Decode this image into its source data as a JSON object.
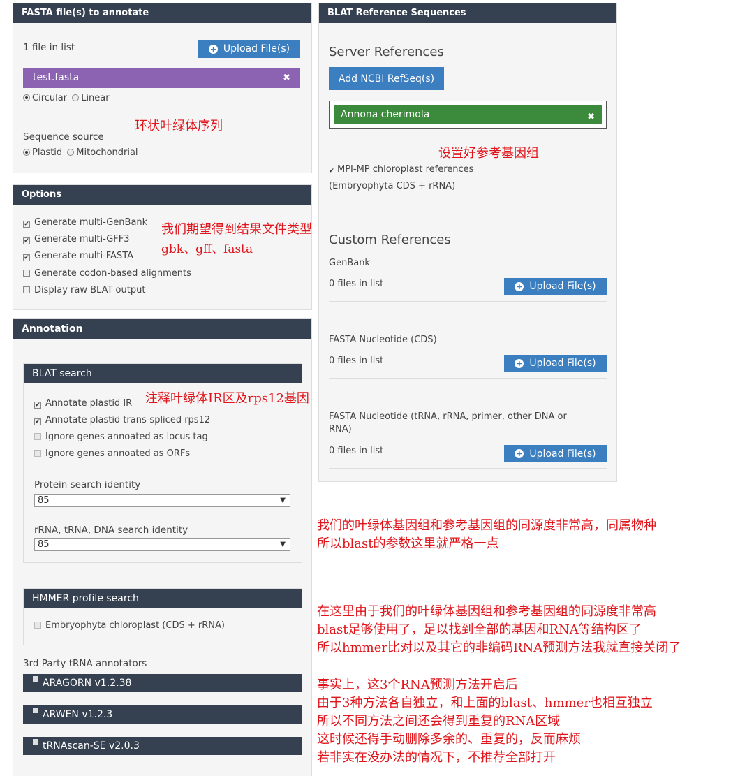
{
  "fasta_panel": {
    "title": "FASTA file(s) to annotate",
    "file_count": "1 file in list",
    "upload_label": "Upload File(s)",
    "file_name": "test.fasta",
    "remove_glyph": "✖",
    "topology_circular": "Circular",
    "topology_linear": "Linear",
    "sequence_source_label": "Sequence source",
    "source_plastid": "Plastid",
    "source_mitochondrial": "Mitochondrial"
  },
  "options_panel": {
    "title": "Options",
    "items": [
      {
        "label": "Generate multi-GenBank",
        "checked": true
      },
      {
        "label": "Generate multi-GFF3",
        "checked": true
      },
      {
        "label": "Generate multi-FASTA",
        "checked": true
      },
      {
        "label": "Generate codon-based alignments",
        "checked": false
      },
      {
        "label": "Display raw BLAT output",
        "checked": false
      }
    ]
  },
  "annotation_panel": {
    "title": "Annotation",
    "blat": {
      "title": "BLAT search",
      "items": [
        {
          "label": "Annotate plastid IR",
          "checked": true
        },
        {
          "label": "Annotate plastid trans-spliced rps12",
          "checked": true
        },
        {
          "label": "Ignore genes annoated as locus tag",
          "checked": false
        },
        {
          "label": "Ignore genes annoated as ORFs",
          "checked": false
        }
      ],
      "protein_identity_label": "Protein search identity",
      "protein_identity_value": "85",
      "dna_identity_label": "rRNA, tRNA, DNA search identity",
      "dna_identity_value": "85"
    },
    "hmmer": {
      "title": "HMMER profile search",
      "item": "Embryophyta chloroplast (CDS + rRNA)"
    },
    "third_party_label": "3rd Party tRNA annotators",
    "third_party": [
      "ARAGORN v1.2.38",
      "ARWEN v1.2.3",
      "tRNAscan-SE v2.0.3"
    ]
  },
  "blat_ref_panel": {
    "title": "BLAT Reference Sequences",
    "server_refs_heading": "Server References",
    "add_ncbi_label": "Add NCBI RefSeq(s)",
    "selected_ref": "Annona cherimola",
    "remove_glyph": "✖",
    "mpi_line1": "MPI-MP chloroplast references",
    "mpi_line2": "(Embryophyta CDS + rRNA)",
    "custom_refs_heading": "Custom References",
    "genbank_label": "GenBank",
    "genbank_count": "0 files in list",
    "cds_label": "FASTA Nucleotide (CDS)",
    "cds_count": "0 files in list",
    "other_label_line1": "FASTA Nucleotide (tRNA, rRNA, primer, other DNA or",
    "other_label_line2": "RNA)",
    "other_count": "0 files in list",
    "upload_label": "Upload File(s)"
  },
  "annotations": {
    "circular": "环状叶绿体序列",
    "reference": "设置好参考基因组",
    "result_types_line1": "我们期望得到结果文件类型",
    "result_types_line2": "gbk、gff、fasta",
    "ir_rps12": "注释叶绿体IR区及rps12基因",
    "blast_note_line1": "我们的叶绿体基因组和参考基因组的同源度非常高，同属物种",
    "blast_note_line2": "所以blast的参数这里就严格一点",
    "hmmer_note_line1": "在这里由于我们的叶绿体基因组和参考基因组的同源度非常高",
    "hmmer_note_line2": "blast足够使用了，足以找到全部的基因和RNA等结构区了",
    "hmmer_note_line3": "所以hmmer比对以及其它的非编码RNA预测方法我就直接关闭了",
    "trna_note_line1": "事实上，这3个RNA预测方法开启后",
    "trna_note_line2": "由于3种方法各自独立，和上面的blast、hmmer也相互独立",
    "trna_note_line3": "所以不同方法之间还会得到重复的RNA区域",
    "trna_note_line4": "这时候还得手动删除多余的、重复的，反而麻烦",
    "trna_note_line5": "若非实在没办法的情况下，不推荐全部打开"
  },
  "colors": {
    "panel_header": "#354050",
    "button_blue": "#3b7fc0",
    "file_purple": "#8c63b3",
    "ref_green": "#3c8a3c",
    "annotation_red": "#e0151b"
  },
  "icons": {
    "upload": "plus-circle-icon",
    "remove": "close-x-icon",
    "dropdown": "triangle-down-icon"
  }
}
